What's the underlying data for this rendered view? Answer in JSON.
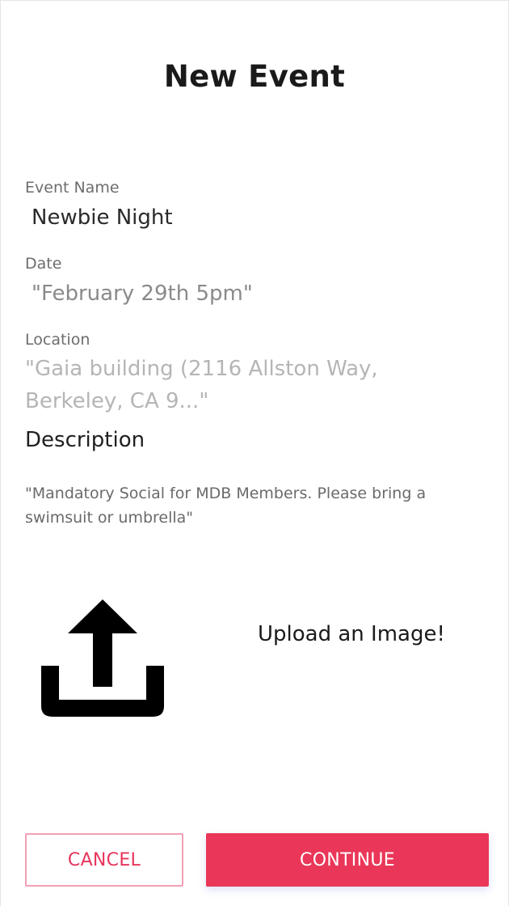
{
  "header": {
    "title": "New Event"
  },
  "form": {
    "event_name": {
      "label": "Event Name",
      "value": "Newbie Night"
    },
    "date": {
      "label": "Date",
      "value": "\"February 29th 5pm\""
    },
    "location": {
      "label": "Location",
      "value": "\"Gaia building (2116 Allston Way, Berkeley, CA 9...\""
    },
    "description": {
      "label": "Description",
      "value": "\"Mandatory Social for MDB Members. Please bring a swimsuit or umbrella\""
    }
  },
  "upload": {
    "icon": "upload-icon",
    "label": "Upload an Image!"
  },
  "actions": {
    "cancel_label": "CANCEL",
    "continue_label": "CONTINUE"
  },
  "colors": {
    "accent": "#ea3658",
    "cancel_border": "#f2a0b4",
    "label_gray": "#6d6d6d",
    "placeholder_gray": "#b5b5b5"
  }
}
